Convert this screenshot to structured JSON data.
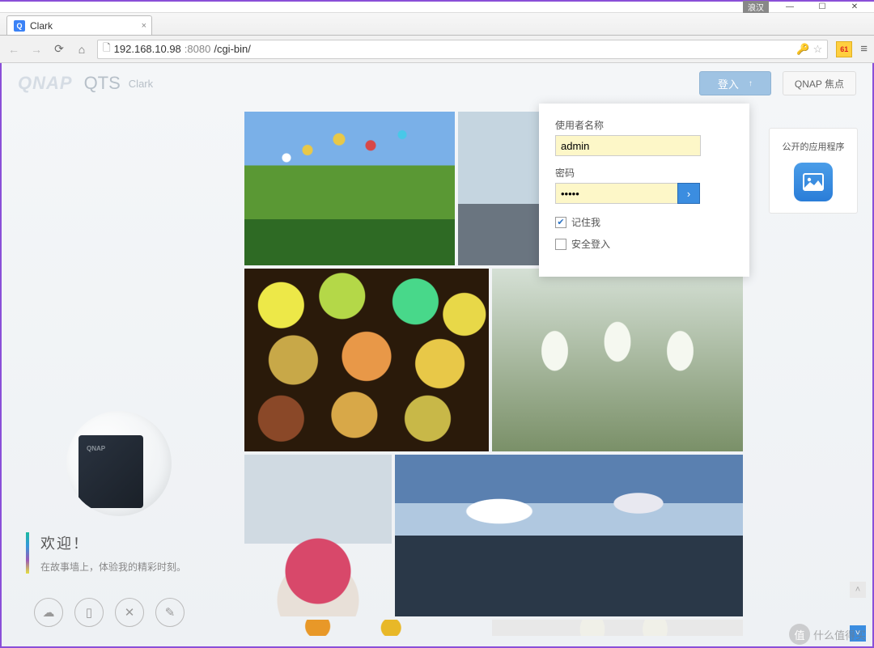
{
  "window": {
    "titlebar_tag": "浪汉",
    "minimize": "—",
    "maximize": "☐",
    "close": "✕"
  },
  "browser": {
    "tab_favicon": "Q",
    "tab_title": "Clark",
    "url_host": "192.168.10.98",
    "url_port": ":8080",
    "url_path": "/cgi-bin/",
    "ext_badge": "61"
  },
  "header": {
    "brand": "QNAP",
    "product": "QTS",
    "device": "Clark",
    "login_btn": "登入",
    "login_arrow": "↑",
    "focus_btn": "QNAP 焦点"
  },
  "login": {
    "user_label": "使用者名称",
    "user_value": "admin",
    "pw_label": "密码",
    "pw_value": "•••••",
    "remember": "记住我",
    "secure": "安全登入",
    "go": "›"
  },
  "welcome": {
    "title": "欢迎！",
    "subtitle": "在故事墙上，体验我的精彩时刻。"
  },
  "apps": {
    "title": "公开的应用程序"
  },
  "icons": {
    "cloud": "cloud-icon",
    "mobile": "mobile-icon",
    "tools": "tools-icon",
    "edit": "edit-icon",
    "photo_app": "photo-app-icon"
  },
  "watermark": {
    "badge": "值",
    "text": "什么值得买"
  }
}
